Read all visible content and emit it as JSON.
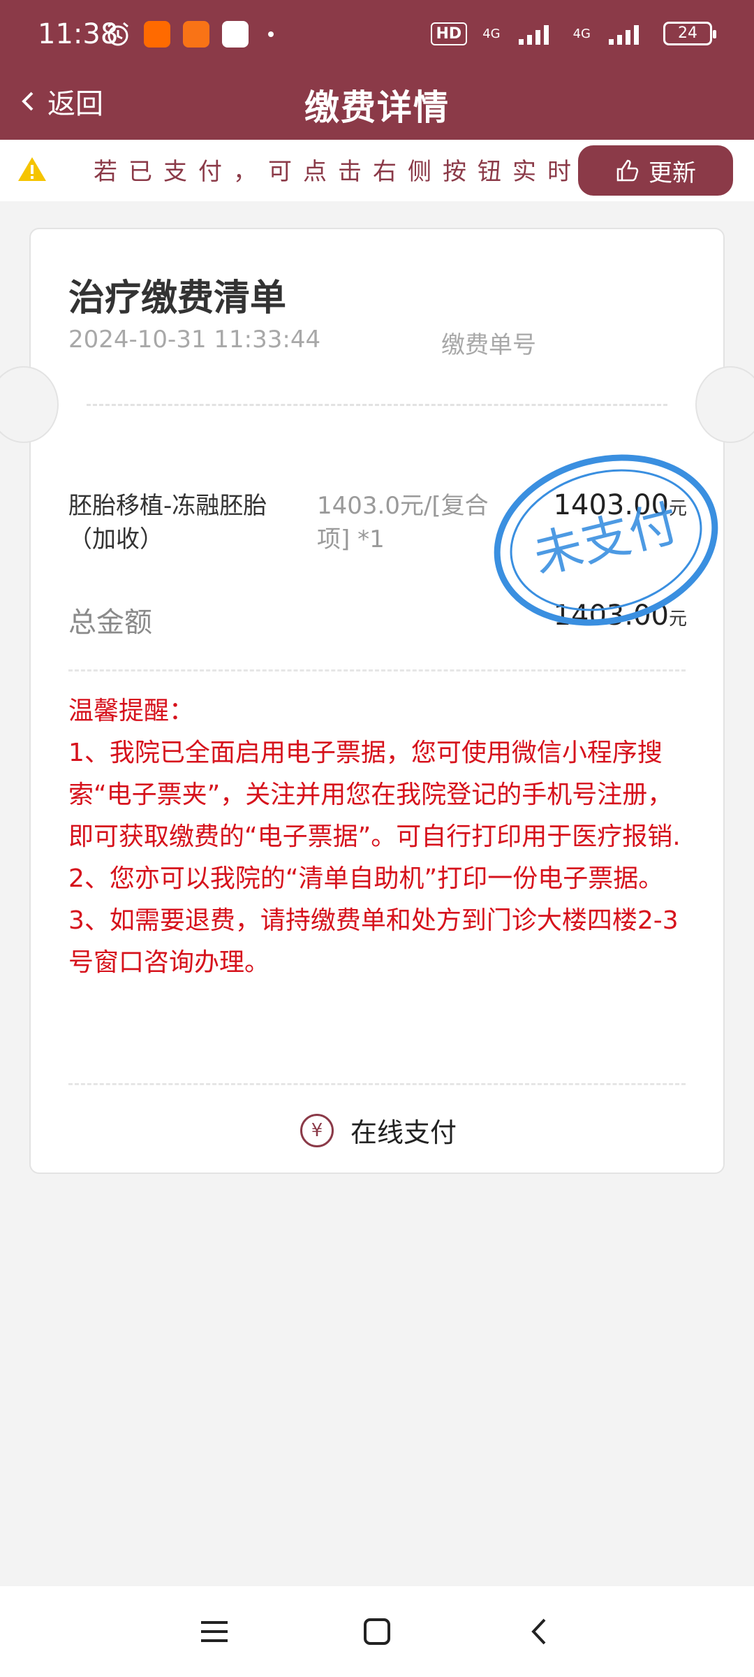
{
  "status_bar": {
    "time": "11:38",
    "hd_label": "HD",
    "network_1": "4G",
    "network_2": "4G",
    "battery": "24"
  },
  "header": {
    "back_label": "返回",
    "title": "缴费详情"
  },
  "notice": {
    "text": "若已支付，可点击右侧按钮实时更新",
    "button_label": "更新"
  },
  "card": {
    "title": "治疗缴费清单",
    "datetime": "2024-10-31 11:33:44",
    "order_no_label": "缴费单号",
    "items": [
      {
        "name": "胚胎移植-冻融胚胎（加收）",
        "price": "1403.0元/[复合项] *1",
        "amount": "1403.00",
        "unit": "元"
      }
    ],
    "total_label": "总金额",
    "total_amount": "1403.00",
    "total_unit": "元",
    "stamp_text": "未支付",
    "tips_title": "温馨提醒：",
    "tips": [
      "1、我院已全面启用电子票据，您可使用微信小程序搜索“电子票夹”，关注并用您在我院登记的手机号注册，即可获取缴费的“电子票据”。可自行打印用于医疗报销.",
      "2、您亦可以我院的“清单自助机”打印一份电子票据。",
      "3、如需要退费，请持缴费单和处方到门诊大楼四楼2-3号窗口咨询办理。"
    ],
    "pay_label": "在线支付",
    "pay_icon_glyph": "¥"
  },
  "colors": {
    "brand": "#8b3a48",
    "tips_red": "#d6121c",
    "stamp_blue": "#3a8fe0"
  }
}
